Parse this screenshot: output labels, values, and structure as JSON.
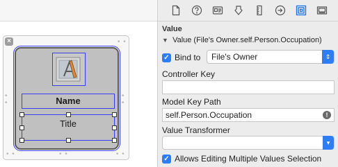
{
  "canvas": {
    "close_glyph": "×",
    "name_label": "Name",
    "title_label": "Title",
    "image_icon": "application-icon"
  },
  "inspector": {
    "tabs": [
      {
        "icon": "file-icon"
      },
      {
        "icon": "help-icon"
      },
      {
        "icon": "identity-icon"
      },
      {
        "icon": "attributes-icon"
      },
      {
        "icon": "size-icon"
      },
      {
        "icon": "connections-icon"
      },
      {
        "icon": "bindings-icon",
        "active": true
      },
      {
        "icon": "view-effects-icon"
      }
    ],
    "section_title": "Value",
    "binding_summary": "Value (File's Owner.self.Person.Occupation)",
    "bind_to_label": "Bind to",
    "bind_to_checked": true,
    "bind_to_value": "File's Owner",
    "controller_key_label": "Controller Key",
    "controller_key_value": "",
    "model_key_path_label": "Model Key Path",
    "model_key_path_value": "self.Person.Occupation",
    "value_transformer_label": "Value Transformer",
    "value_transformer_value": "",
    "allows_editing_label": "Allows Editing Multiple Values Selection",
    "allows_editing_checked": true,
    "accent_color": "#2d7df6",
    "selection_color": "#3b3bff"
  }
}
